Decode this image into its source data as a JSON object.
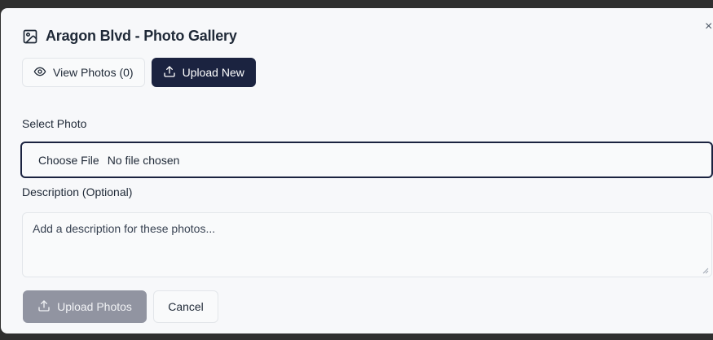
{
  "dialog": {
    "title": "Aragon Blvd - Photo Gallery",
    "close_symbol": "×"
  },
  "tabs": [
    {
      "label": "View Photos (0)",
      "icon": "eye-icon"
    },
    {
      "label": "Upload New",
      "icon": "upload-icon"
    }
  ],
  "form": {
    "file_label": "Select Photo",
    "file_button": "Choose File",
    "file_status": "No file chosen",
    "description_label": "Description (Optional)",
    "description_placeholder": "Add a description for these photos..."
  },
  "actions": {
    "upload_label": "Upload Photos",
    "cancel_label": "Cancel"
  },
  "colors": {
    "primary": "#1b2340",
    "disabled": "#9194a1",
    "background": "#f7f8fa"
  }
}
